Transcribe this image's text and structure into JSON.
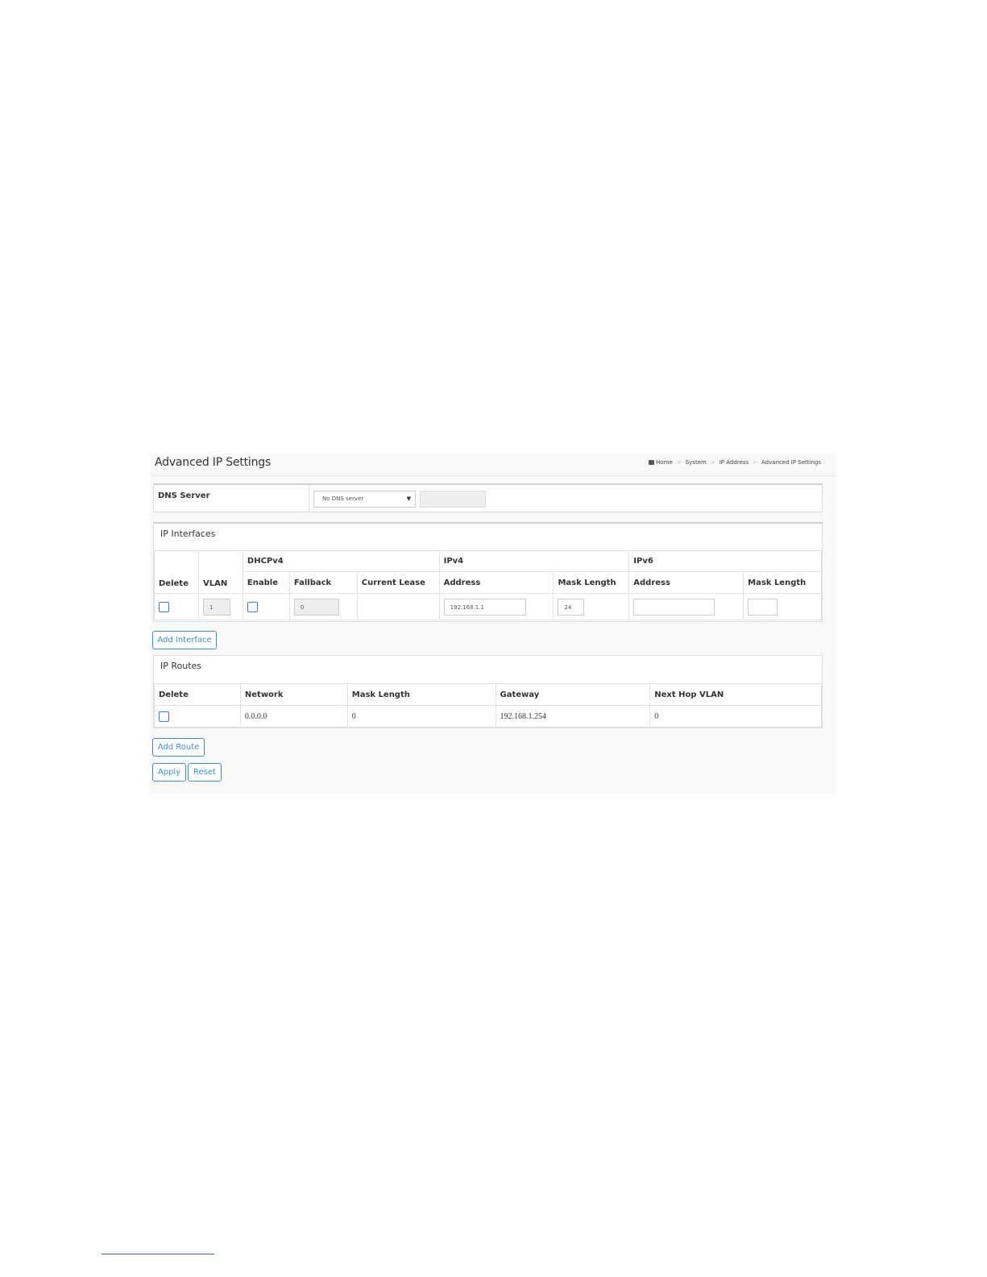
{
  "header": {
    "title": "Advanced IP Settings",
    "breadcrumb": [
      "Home",
      "System",
      "IP Address",
      "Advanced IP Settings"
    ],
    "breadcrumb_sep": ">"
  },
  "dns": {
    "label": "DNS Server",
    "select_value": "No DNS server",
    "caret": "▼"
  },
  "ip_interfaces": {
    "title": "IP Interfaces",
    "groups": {
      "dhcpv4": "DHCPv4",
      "ipv4": "IPv4",
      "ipv6": "IPv6"
    },
    "columns": {
      "delete": "Delete",
      "vlan": "VLAN",
      "enable": "Enable",
      "fallback": "Fallback",
      "current_lease": "Current Lease",
      "ipv4_address": "Address",
      "ipv4_mask": "Mask Length",
      "ipv6_address": "Address",
      "ipv6_mask": "Mask Length"
    },
    "row": {
      "vlan": "1",
      "fallback": "0",
      "current_lease": "",
      "ipv4_address": "192.168.1.1",
      "ipv4_mask": "24",
      "ipv6_address": "",
      "ipv6_mask": ""
    },
    "add_button": "Add Interface"
  },
  "ip_routes": {
    "title": "IP Routes",
    "columns": {
      "delete": "Delete",
      "network": "Network",
      "mask": "Mask Length",
      "gateway": "Gateway",
      "next_hop": "Next Hop VLAN"
    },
    "row": {
      "network": "0.0.0.0",
      "mask": "0",
      "gateway": "192.168.1.254",
      "next_hop": "0"
    },
    "add_button": "Add Route"
  },
  "actions": {
    "apply": "Apply",
    "reset": "Reset"
  }
}
